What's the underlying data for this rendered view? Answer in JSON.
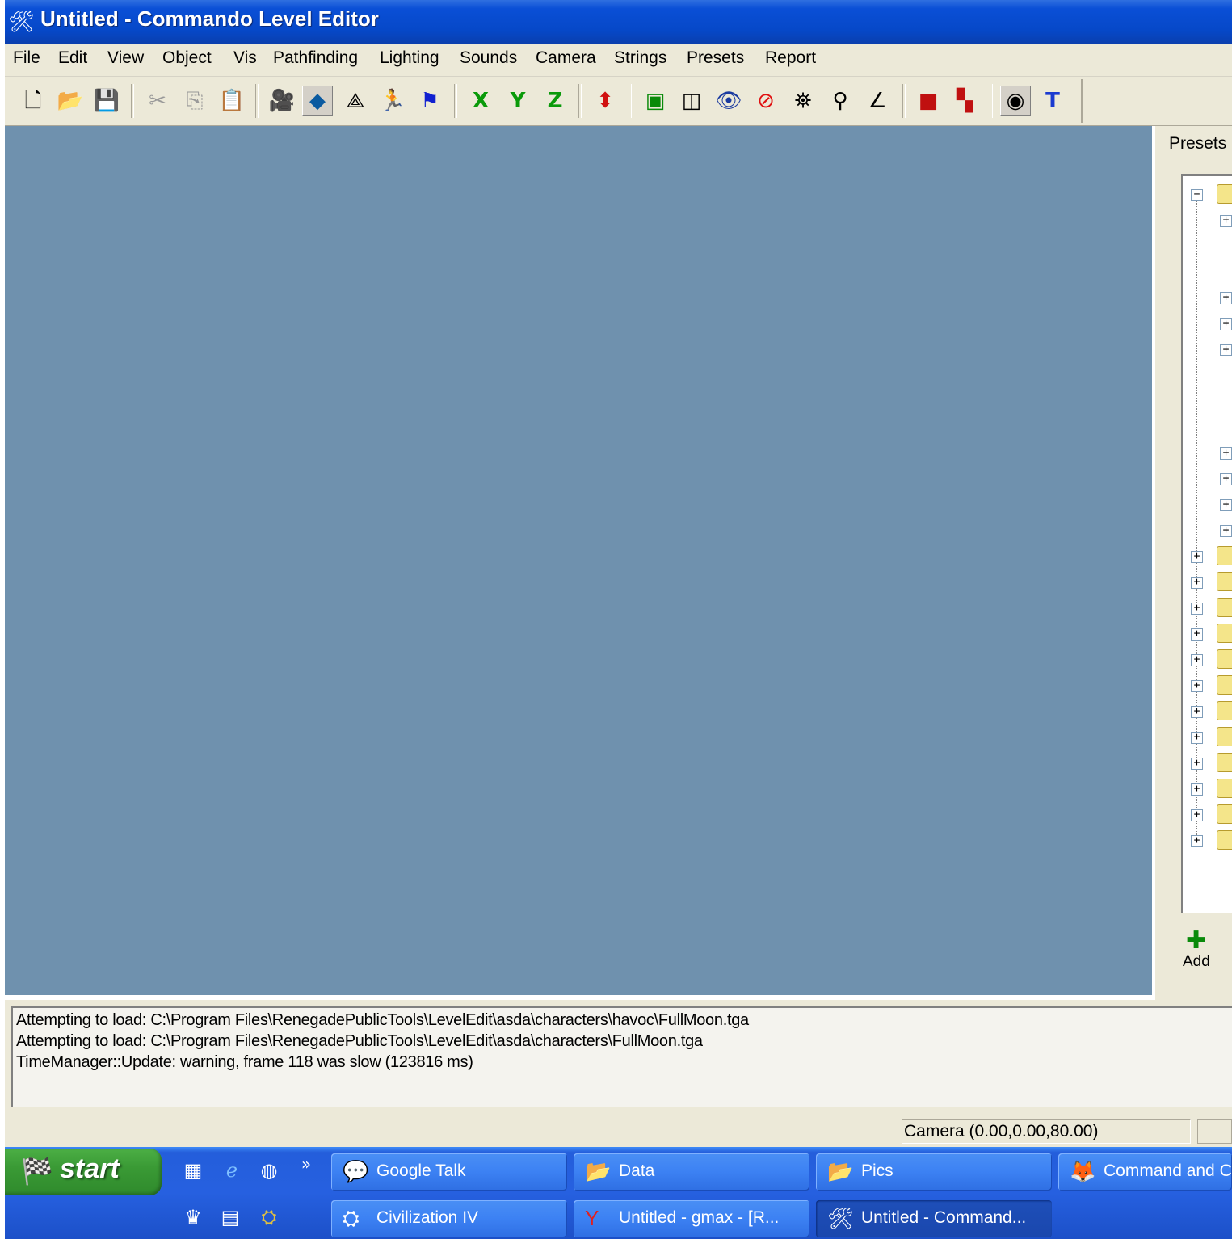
{
  "window": {
    "title": "Untitled - Commando Level Editor",
    "title_icon": "wrench-hammer-icon"
  },
  "menu": [
    "File",
    "Edit",
    "View",
    "Object",
    "Vis",
    "Pathfinding",
    "Lighting",
    "Sounds",
    "Camera",
    "Strings",
    "Presets",
    "Report"
  ],
  "toolbar": {
    "x_label": "X",
    "y_label": "Y",
    "z_label": "Z",
    "text_tool_label": "T"
  },
  "presets": {
    "title": "Presets",
    "add_label": "Add"
  },
  "log": [
    "Attempting to load: C:\\Program Files\\RenegadePublicTools\\LevelEdit\\asda\\characters\\havoc\\FullMoon.tga",
    "Attempting to load: C:\\Program Files\\RenegadePublicTools\\LevelEdit\\asda\\characters\\FullMoon.tga",
    "TimeManager::Update: warning, frame 118 was slow (123816 ms)"
  ],
  "status": {
    "camera": "Camera (0.00,0.00,80.00)"
  },
  "taskbar": {
    "start_label": "start",
    "quicklaunch_overflow": "»",
    "tasks_row1": [
      "Google Talk",
      "Data",
      "Pics",
      "Command and C"
    ],
    "tasks_row2": [
      "Civilization IV",
      "Untitled - gmax - [R...",
      "Untitled - Command..."
    ]
  },
  "colors": {
    "viewport_bg": "#6f91ae",
    "titlebar": "#0648c8",
    "taskbar": "#245edb",
    "start_button": "#3a9a35",
    "axis_icon": "#0a9a0a"
  }
}
